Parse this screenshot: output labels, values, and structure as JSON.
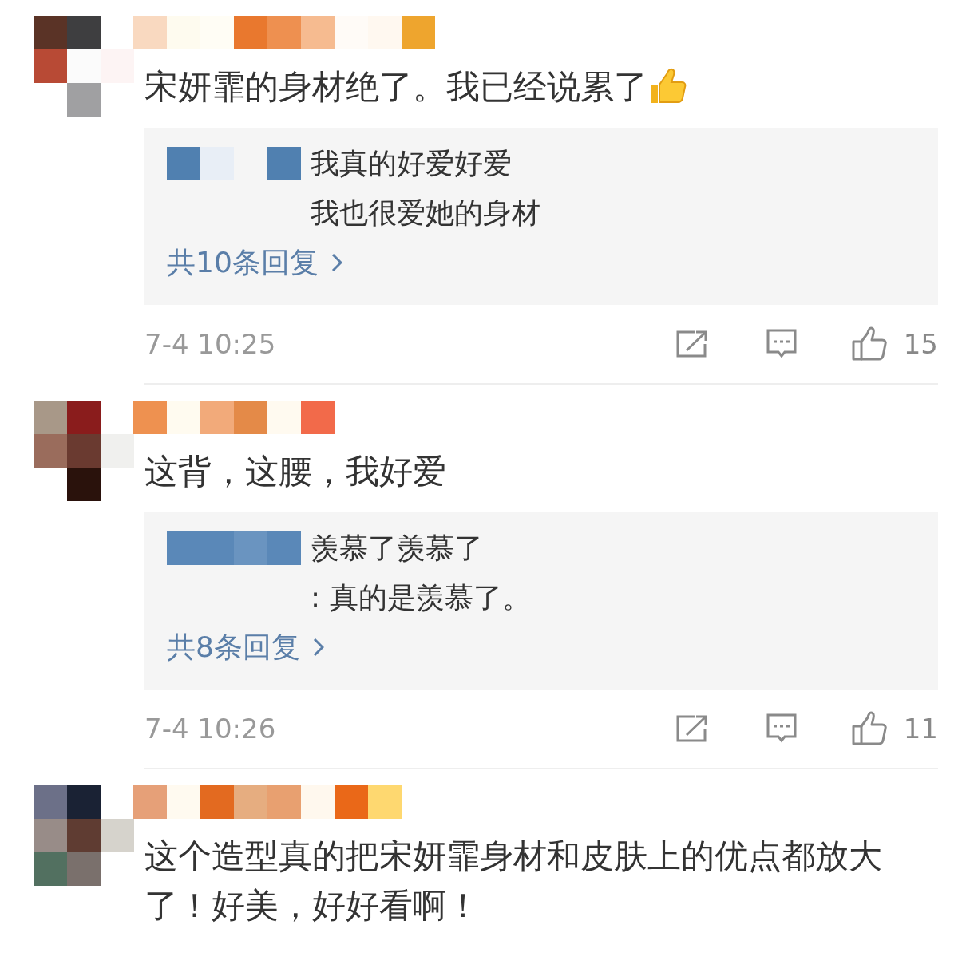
{
  "comments": [
    {
      "text": "宋妍霏的身材绝了。我已经说累了",
      "thumb_emoji": true,
      "replies": [
        {
          "text": "我真的好爱好爱"
        },
        {
          "text": "我也很爱她的身材"
        }
      ],
      "more_replies": "共10条回复",
      "time": "7-4 10:25",
      "likes": "15"
    },
    {
      "text": "这背，这腰，我好爱",
      "replies": [
        {
          "text": "羡慕了羡慕了"
        },
        {
          "text": ": 真的是羡慕了。"
        }
      ],
      "more_replies": "共8条回复",
      "time": "7-4 10:26",
      "likes": "11"
    },
    {
      "text": "这个造型真的把宋妍霏身材和皮肤上的优点都放大了！好美，好好看啊！"
    }
  ]
}
